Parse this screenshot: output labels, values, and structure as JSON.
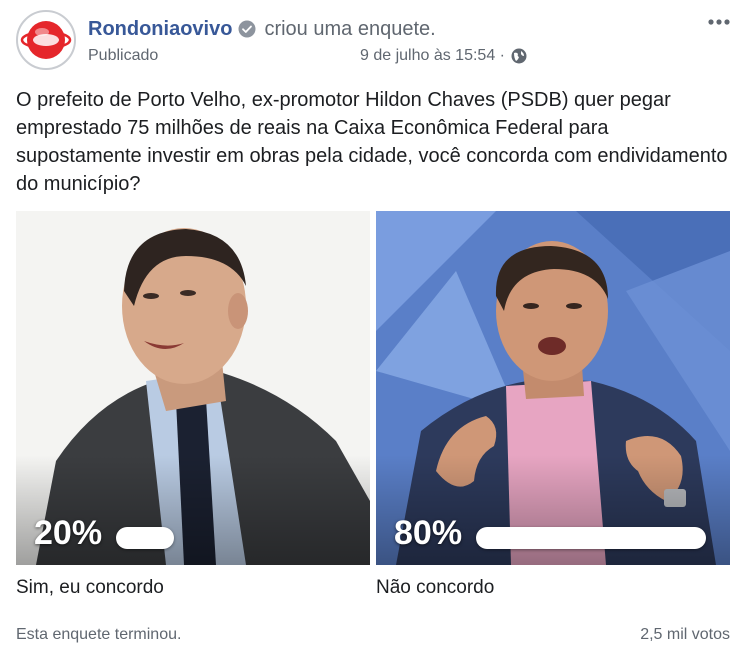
{
  "header": {
    "page_name": "Rondoniaovivo",
    "action": "criou uma enquete.",
    "status": "Publicado",
    "timestamp": "9 de julho às 15:54 ·",
    "verified_icon": "verified-badge-icon",
    "privacy_icon": "globe-icon",
    "more_icon": "more-options-icon"
  },
  "question": "O prefeito de Porto Velho, ex-promotor Hildon Chaves (PSDB) quer pegar emprestado 75 milhões de reais na Caixa Econômica Federal para supostamente investir em obras pela cidade, você concorda com endividamento do município?",
  "poll": {
    "options": [
      {
        "percent_label": "20%",
        "percent": 20,
        "label": "Sim, eu concordo"
      },
      {
        "percent_label": "80%",
        "percent": 80,
        "label": "Não concordo"
      }
    ],
    "status": "Esta enquete terminou.",
    "votes": "2,5 mil votos"
  },
  "colors": {
    "link": "#385898",
    "muted": "#606770",
    "text": "#1c1e21",
    "avatar_red": "#e5262b"
  }
}
